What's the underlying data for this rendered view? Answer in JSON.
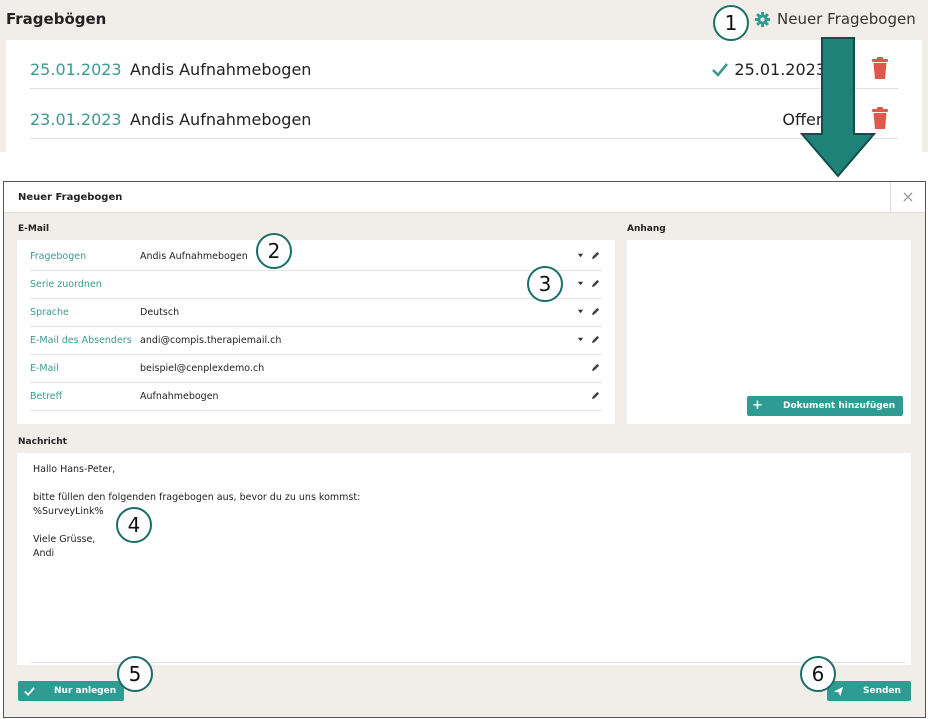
{
  "header": {
    "title": "Fragebögen",
    "new_button_label": "Neuer Fragebogen"
  },
  "questionnaires": [
    {
      "date": "25.01.2023",
      "name": "Andis Aufnahmebogen",
      "status": "25.01.2023",
      "status_icon": "check-icon"
    },
    {
      "date": "23.01.2023",
      "name": "Andis Aufnahmebogen",
      "status": "Offen",
      "status_icon": ""
    }
  ],
  "modal": {
    "title": "Neuer Fragebogen",
    "close_glyph": "×",
    "email_section_label": "E-Mail",
    "attachment_section_label": "Anhang",
    "message_section_label": "Nachricht",
    "fields": [
      {
        "label": "Fragebogen",
        "value": "Andis Aufnahmebogen",
        "dropdown": true
      },
      {
        "label": "Serie zuordnen",
        "value": "",
        "dropdown": true
      },
      {
        "label": "Sprache",
        "value": "Deutsch",
        "dropdown": true
      },
      {
        "label": "E-Mail des Absenders",
        "value": "andi@compis.therapiemail.ch",
        "dropdown": true
      },
      {
        "label": "E-Mail",
        "value": "beispiel@cenplexdemo.ch",
        "dropdown": false
      },
      {
        "label": "Betreff",
        "value": "Aufnahmebogen",
        "dropdown": false
      }
    ],
    "attach_button_label": "Dokument hinzufügen",
    "message": "Hallo Hans-Peter,\n\nbitte füllen den folgenden fragebogen aus, bevor du zu uns kommst:\n%SurveyLink%\n\nViele Grüsse,\nAndi",
    "create_only_label": "Nur anlegen",
    "send_label": "Senden"
  },
  "callouts": [
    "1",
    "2",
    "3",
    "4",
    "5",
    "6"
  ],
  "colors": {
    "accent": "#2f9c93",
    "link_text": "#3a9a92",
    "trash": "#e0584a",
    "arrow": "#1f8278",
    "panel_bg": "#f1eeea"
  }
}
